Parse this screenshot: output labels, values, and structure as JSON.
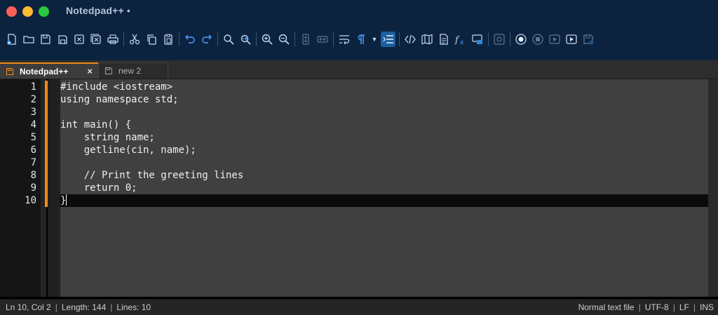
{
  "window": {
    "title": "Notedpad++",
    "modified_marker": "•"
  },
  "toolbar": {
    "icons": [
      "new-file-icon",
      "open-folder-icon",
      "save-icon",
      "save-all-icon",
      "close-icon",
      "close-all-icon",
      "print-icon",
      "cut-icon",
      "copy-icon",
      "paste-icon",
      "undo-icon",
      "redo-icon",
      "find-icon",
      "replace-icon",
      "zoom-in-icon",
      "zoom-out-icon",
      "sync-vertical-icon",
      "sync-horizontal-icon",
      "word-wrap-icon",
      "show-all-chars-icon",
      "indent-guide-icon",
      "user-language-icon",
      "document-map-icon",
      "doc-list-icon",
      "function-list-icon",
      "folder-workspace-icon",
      "monitoring-icon",
      "record-macro-icon",
      "stop-macro-icon",
      "play-macro-icon",
      "run-macro-multiple-icon",
      "save-macro-icon"
    ]
  },
  "tabs": [
    {
      "label": "Notedpad++",
      "close": "×",
      "active": true
    },
    {
      "label": "new 2",
      "active": false
    }
  ],
  "editor": {
    "line_numbers": [
      "1",
      "2",
      "3",
      "4",
      "5",
      "6",
      "7",
      "8",
      "9",
      "10"
    ],
    "lines": [
      "#include <iostream>",
      "using namespace std;",
      "",
      "int main() {",
      "    string name;",
      "    getline(cin, name);",
      "",
      "    // Print the greeting lines",
      "    return 0;",
      "}"
    ],
    "current_line": 10
  },
  "status": {
    "position": "Ln 10, Col 2",
    "length": "Length: 144",
    "lines": "Lines: 10",
    "file_type": "Normal text file",
    "encoding": "UTF-8",
    "eol": "LF",
    "mode": "INS"
  },
  "colors": {
    "accent": "#f08a1c",
    "toolbar_bg": "#0c2340",
    "icon": "#c8d6ea",
    "editor_bg": "#404040"
  }
}
